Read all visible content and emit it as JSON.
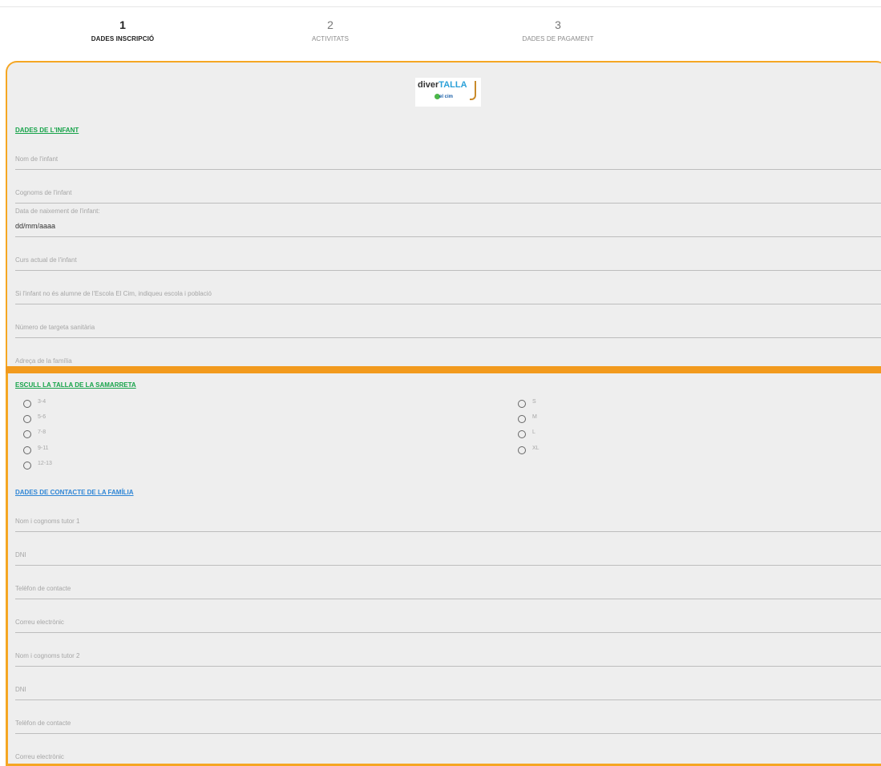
{
  "steps": [
    {
      "num": "1",
      "label": "DADES INSCRIPCIÓ"
    },
    {
      "num": "2",
      "label": "ACTIVITATS"
    },
    {
      "num": "3",
      "label": "DADES DE PAGAMENT"
    }
  ],
  "logo": {
    "text_a": "diver",
    "text_b": "TALLA",
    "sub": "el cim"
  },
  "child_section": {
    "title": "DADES DE L'INFANT",
    "fields": [
      "Nom de l'infant",
      "Cognoms de l'infant",
      "Data de naixement de l'infant:",
      "Curs actual de l'infant",
      "Si l'infant no és alumne de l'Escola El Cim, indiqueu escola i població",
      "Número de targeta sanitària",
      "Adreça de la família"
    ],
    "date_value": "dd/mm/aaaa"
  },
  "shirt_section": {
    "title": "ESCULL LA TALLA DE LA SAMARRETA",
    "col1": [
      "3-4",
      "5-6",
      "7-8",
      "9-11",
      "12-13"
    ],
    "col2": [
      "S",
      "M",
      "L",
      "XL"
    ]
  },
  "family_section": {
    "title": "DADES DE CONTACTE DE LA FAMÍLIA",
    "fields": [
      "Nom i cognoms tutor 1",
      "DNI",
      "Telèfon de contacte",
      "Correu electrònic",
      "Nom i cognoms tutor 2",
      "DNI",
      "Telèfon de contacte",
      "Correu electrònic"
    ]
  },
  "colors": {
    "accent": "#f5a623",
    "green_title": "#17a34a",
    "blue_title": "#2f86d6",
    "panel_bg": "#eeeeee"
  }
}
